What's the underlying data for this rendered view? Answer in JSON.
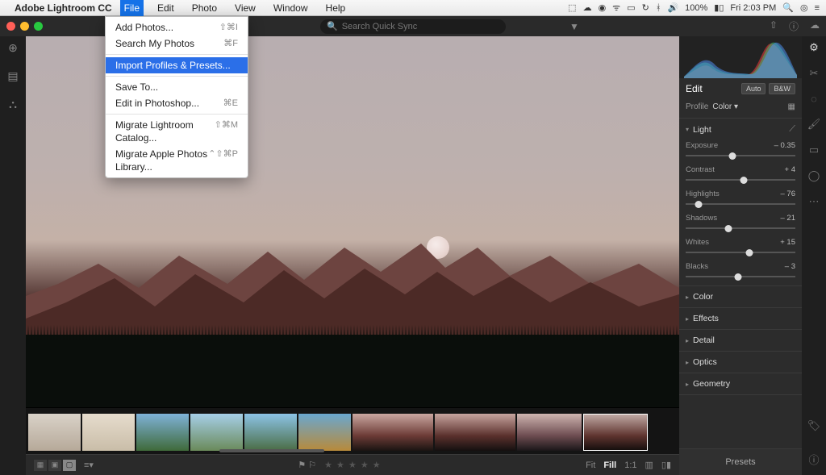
{
  "menubar": {
    "apple_glyph": "",
    "app_name": "Adobe Lightroom CC",
    "items": [
      "File",
      "Edit",
      "Photo",
      "View",
      "Window",
      "Help"
    ],
    "open_item": "File",
    "right": {
      "battery": "100%",
      "clock": "Fri 2:03 PM"
    }
  },
  "file_menu": {
    "groups": [
      [
        {
          "label": "Add Photos...",
          "shortcut": "⇧⌘I"
        },
        {
          "label": "Search My Photos",
          "shortcut": "⌘F"
        }
      ],
      [
        {
          "label": "Import Profiles & Presets...",
          "shortcut": "",
          "highlight": true
        }
      ],
      [
        {
          "label": "Save To...",
          "shortcut": ""
        },
        {
          "label": "Edit in Photoshop...",
          "shortcut": "⌘E"
        }
      ],
      [
        {
          "label": "Migrate Lightroom Catalog...",
          "shortcut": "⇧⌘M"
        },
        {
          "label": "Migrate Apple Photos Library...",
          "shortcut": "⌃⇧⌘P"
        }
      ]
    ]
  },
  "titlebar": {
    "search_placeholder": "Search Quick Sync"
  },
  "right_panel": {
    "edit_title": "Edit",
    "auto_btn": "Auto",
    "bw_btn": "B&W",
    "profile_label": "Profile",
    "profile_value": "Color",
    "sections": {
      "light": {
        "title": "Light",
        "open": true,
        "sliders": [
          {
            "label": "Exposure",
            "value": "– 0.35",
            "pos": 43
          },
          {
            "label": "Contrast",
            "value": "+ 4",
            "pos": 53
          },
          {
            "label": "Highlights",
            "value": "– 76",
            "pos": 12
          },
          {
            "label": "Shadows",
            "value": "– 21",
            "pos": 39
          },
          {
            "label": "Whites",
            "value": "+ 15",
            "pos": 58
          },
          {
            "label": "Blacks",
            "value": "– 3",
            "pos": 48
          }
        ]
      },
      "collapsed": [
        "Color",
        "Effects",
        "Detail",
        "Optics",
        "Geometry"
      ]
    },
    "presets_label": "Presets"
  },
  "bottombar": {
    "flags": "⚑ ⚐",
    "stars": "★ ★ ★ ★ ★",
    "fit": "Fit",
    "fill": "Fill",
    "one_to_one": "1:1"
  },
  "filmstrip": {
    "count": 10,
    "selected_index": 9
  }
}
